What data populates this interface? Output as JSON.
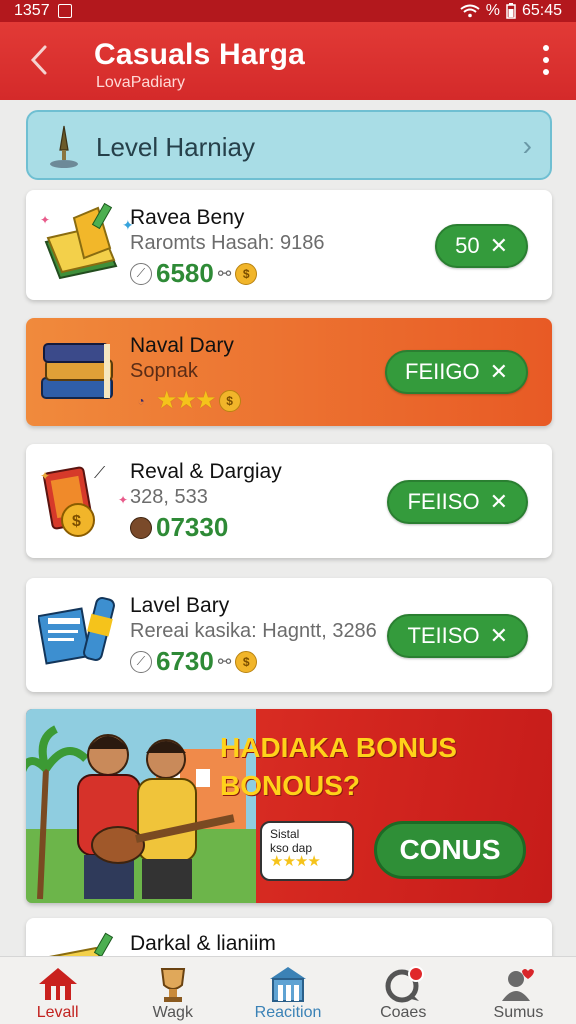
{
  "status_bar": {
    "time_left": "1357",
    "time_right": "65:45",
    "wifi_icon": "wifi-icon",
    "battery_icon": "battery-icon"
  },
  "app_bar": {
    "title": "Casuals Harga",
    "subtitle": "LovaPadiary",
    "back_icon": "back-arrow-icon",
    "more_icon": "more-vert-icon"
  },
  "level_bar": {
    "label": "Level Harniay",
    "icon": "pin-icon",
    "chevron_icon": "chevron-right-icon"
  },
  "cards": [
    {
      "title": "Ravea Beny",
      "subtitle": "Raromts Hasah: 9186",
      "points": "6580",
      "button": "50",
      "icon": "book-icon"
    },
    {
      "title": "Naval Dary",
      "subtitle": "Sopnak",
      "stars": "★★★",
      "button": "FEIIGO",
      "icon": "books-icon"
    },
    {
      "title": "Reval & Dargiay",
      "subtitle": "328, 533",
      "points": "07330",
      "button": "FEIISO",
      "icon": "coin-card-icon"
    },
    {
      "title": "Lavel Bary",
      "subtitle": "Rereai kasika: Hagntt, 3286",
      "points": "6730",
      "button": "TEIISO",
      "icon": "ticket-icon"
    }
  ],
  "promo": {
    "headline_1": "HADIAKA BONUS",
    "headline_2": "BONOUS?",
    "bubble_line_1": "Sistal",
    "bubble_line_2": "kso dap",
    "bubble_stars": "★★★★",
    "cta": "CONUS"
  },
  "partial_card": {
    "title": "Darkal & lianiim"
  },
  "bottom_nav": [
    {
      "label": "Levall",
      "icon": "home-icon"
    },
    {
      "label": "Wagk",
      "icon": "trophy-icon"
    },
    {
      "label": "Reacition",
      "icon": "building-icon"
    },
    {
      "label": "Coaes",
      "icon": "chat-icon"
    },
    {
      "label": "Sumus",
      "icon": "user-heart-icon"
    }
  ],
  "colors": {
    "brand_red": "#d42a2a",
    "accent_green": "#349b3c",
    "level_bar_bg": "#a9dde6",
    "orange_card": "#e85a25"
  }
}
